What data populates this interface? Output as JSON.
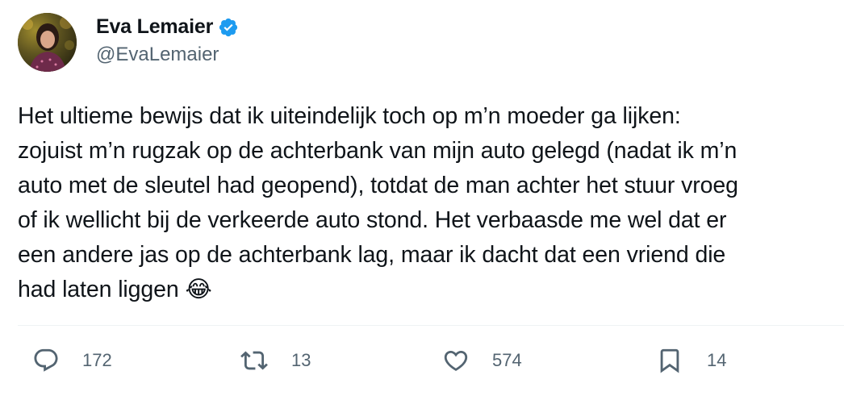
{
  "author": {
    "display_name": "Eva Lemaier",
    "handle": "@EvaLemaier",
    "verified": true,
    "verified_color": "#1d9bf0"
  },
  "tweet": {
    "text": "Het ultieme bewijs dat ik uiteindelijk toch op m’n moeder ga lijken:\nzojuist m’n rugzak op de achterbank van mijn auto gelegd (nadat ik m’n\nauto met de sleutel had geopend), totdat de man achter het stuur vroeg\nof ik wellicht bij de verkeerde auto stond. Het verbaasde me wel dat er\neen andere jas op de achterbank lag, maar ik dacht dat een vriend die\nhad laten liggen 😂"
  },
  "actions": {
    "replies": "172",
    "retweets": "13",
    "likes": "574",
    "bookmarks": "14"
  },
  "icons": {
    "reply": "reply-icon",
    "retweet": "retweet-icon",
    "like": "heart-icon",
    "bookmark": "bookmark-icon",
    "verified": "verified-badge-icon"
  },
  "colors": {
    "text_primary": "#0f1419",
    "text_secondary": "#536471",
    "divider": "#eff3f4",
    "accent": "#1d9bf0"
  }
}
